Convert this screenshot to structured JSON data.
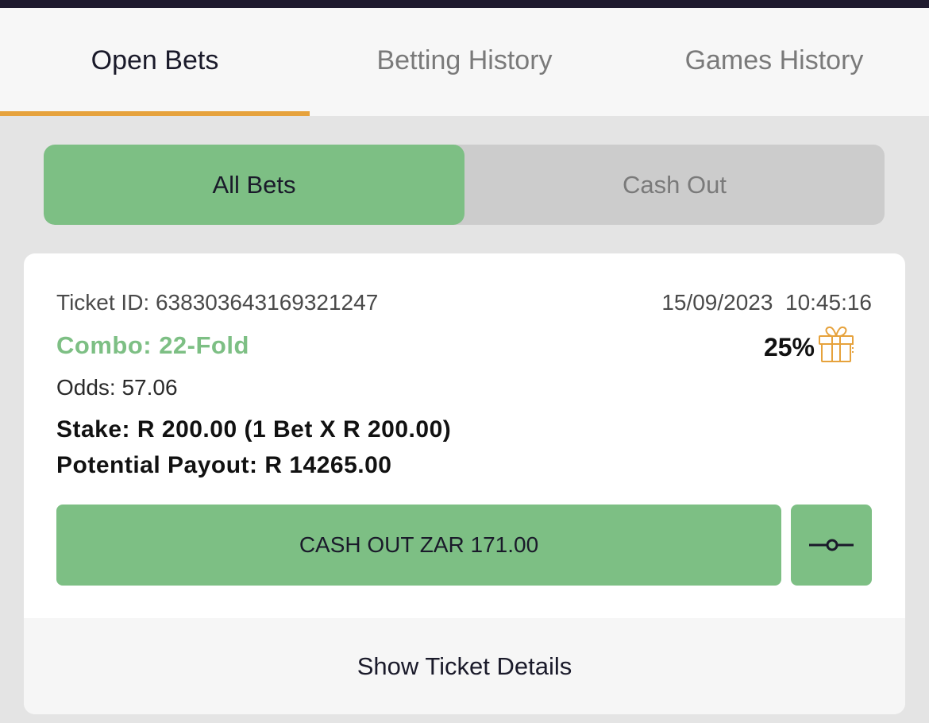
{
  "tabs": [
    {
      "label": "Open Bets",
      "active": true
    },
    {
      "label": "Betting History",
      "active": false
    },
    {
      "label": "Games History",
      "active": false
    }
  ],
  "filter": {
    "all_bets": "All Bets",
    "cash_out": "Cash Out",
    "selected": "All Bets"
  },
  "ticket": {
    "id_text": "Ticket ID: 638303643169321247",
    "datetime": "15/09/2023  10:45:16",
    "combo": "Combo: 22-Fold",
    "bonus_pct": "25%",
    "odds": "Odds: 57.06",
    "stake": "Stake: R 200.00 (1 Bet X R 200.00)",
    "payout": "Potential Payout: R 14265.00",
    "cashout_label": "CASH OUT ZAR 171.00",
    "details_label": "Show Ticket Details"
  },
  "colors": {
    "accent_green": "#7dbf84",
    "tab_underline": "#e6a23c",
    "gift_icon": "#e6a23c",
    "top_bar": "#1f1a2e"
  },
  "icons": {
    "bonus": "gift-icon",
    "cashout_settings": "slider-icon"
  }
}
